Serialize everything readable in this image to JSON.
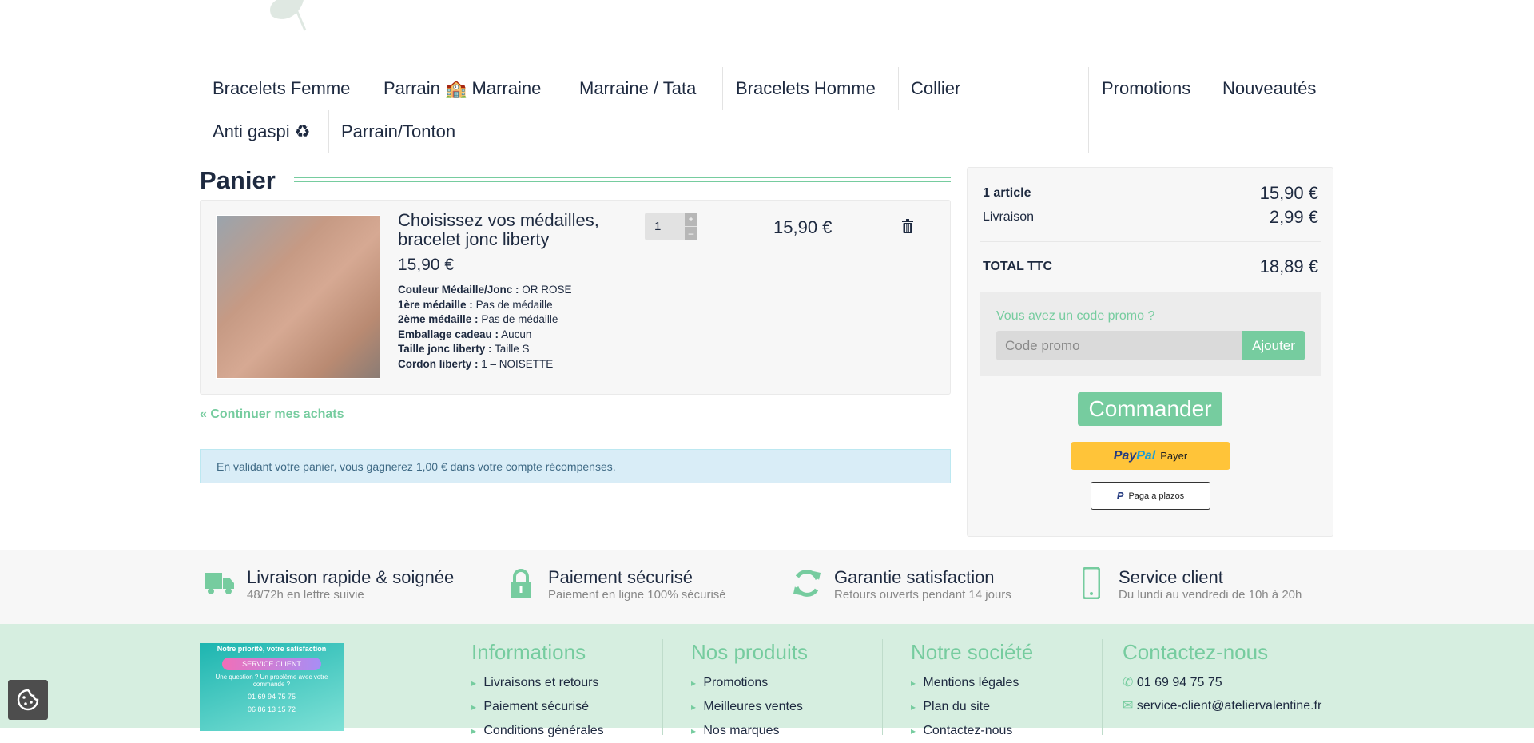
{
  "nav": {
    "items": [
      "Bracelets Femme",
      "Parrain 🏫 Marraine",
      "Marraine / Tata",
      "Bracelets Homme",
      "Collier",
      "Promotions",
      "Nouveautés",
      "Anti gaspi ♻",
      "Parrain/Tonton"
    ]
  },
  "cart": {
    "title": "Panier",
    "item": {
      "name": "Choisissez vos médailles, bracelet jonc liberty",
      "price": "15,90 €",
      "quantity": "1",
      "line_total": "15,90 €",
      "attributes": [
        {
          "label": "Couleur Médaille/Jonc :",
          "value": "OR ROSE"
        },
        {
          "label": "1ère médaille :",
          "value": "Pas de médaille"
        },
        {
          "label": "2ème médaille :",
          "value": "Pas de médaille"
        },
        {
          "label": "Emballage cadeau :",
          "value": "Aucun"
        },
        {
          "label": "Taille jonc liberty :",
          "value": "Taille S"
        },
        {
          "label": "Cordon liberty :",
          "value": "1 – NOISETTE"
        }
      ]
    },
    "continue": "Continuer mes achats",
    "rewards_info": "En validant votre panier, vous gagnerez 1,00 € dans votre compte récompenses."
  },
  "summary": {
    "articles_label": "1 article",
    "articles_value": "15,90 €",
    "shipping_label": "Livraison",
    "shipping_value": "2,99 €",
    "total_label": "TOTAL TTC",
    "total_value": "18,89 €",
    "promo_question": "Vous avez un code promo ?",
    "promo_placeholder": "Code promo",
    "promo_button": "Ajouter",
    "checkout": "Commander",
    "paypal_brand1": "Pay",
    "paypal_brand2": "Pal",
    "paypal_label": "Payer",
    "installments": "Paga a plazos"
  },
  "features": [
    {
      "title": "Livraison rapide & soignée",
      "sub": "48/72h en lettre suivie"
    },
    {
      "title": "Paiement sécurisé",
      "sub": "Paiement en ligne 100% sécurisé"
    },
    {
      "title": "Garantie satisfaction",
      "sub": "Retours ouverts pendant 14 jours"
    },
    {
      "title": "Service client",
      "sub": "Du lundi au vendredi de 10h à 20h"
    }
  ],
  "footer": {
    "banner": {
      "title": "Notre priorité, votre satisfaction",
      "pill": "SERVICE CLIENT",
      "line": "Une question ? Un problème avec votre commande ?",
      "phone1": "01 69 94 75 75",
      "phone2": "06 86 13 15 72"
    },
    "columns": [
      {
        "title": "Informations",
        "links": [
          "Livraisons et retours",
          "Paiement sécurisé",
          "Conditions générales"
        ]
      },
      {
        "title": "Nos produits",
        "links": [
          "Promotions",
          "Meilleures ventes",
          "Nos marques"
        ]
      },
      {
        "title": "Notre société",
        "links": [
          "Mentions légales",
          "Plan du site",
          "Contactez-nous"
        ]
      }
    ],
    "contact": {
      "title": "Contactez-nous",
      "phone": "01 69 94 75 75",
      "email": "service-client@ateliervalentine.fr"
    }
  },
  "colors": {
    "accent": "#76cc9f",
    "text": "#1e2a40",
    "info_bg": "#d9edf7",
    "paypal": "#ffc439",
    "footer_bg": "#d6eee0"
  }
}
